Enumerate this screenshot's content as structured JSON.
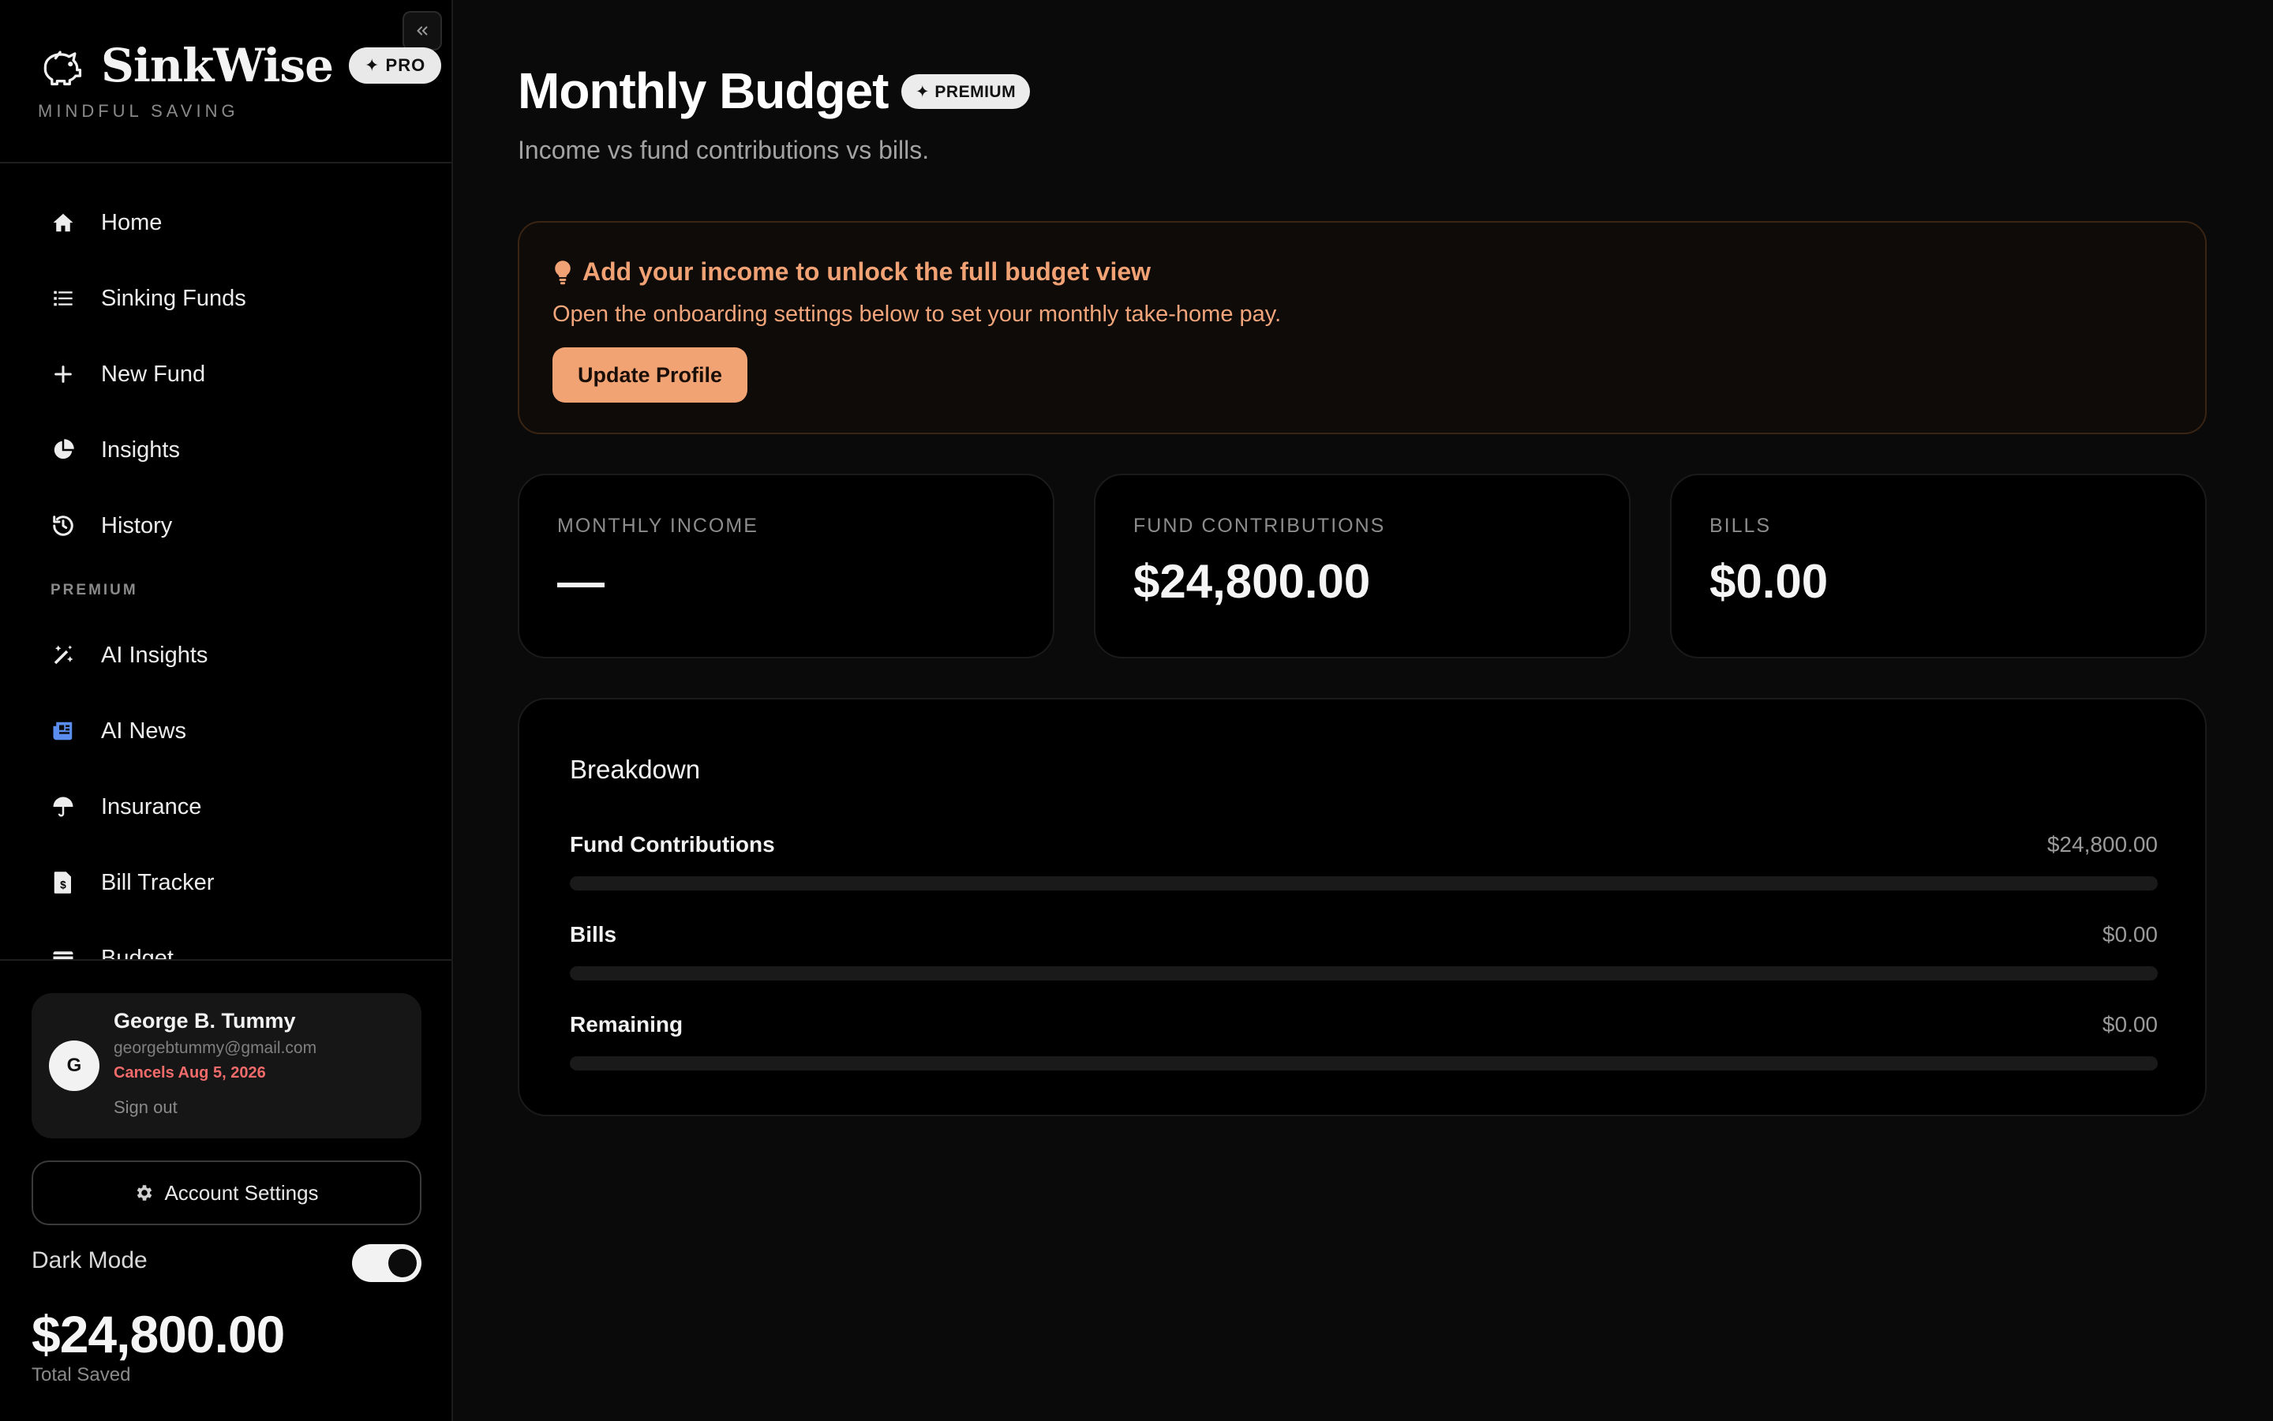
{
  "app": {
    "name": "SinkWise",
    "badge": "✦ PRO",
    "tagline": "MINDFUL SAVING"
  },
  "sidebar": {
    "items": [
      {
        "label": "Home",
        "icon": "home-icon"
      },
      {
        "label": "Sinking Funds",
        "icon": "list-icon"
      },
      {
        "label": "New Fund",
        "icon": "plus-icon"
      },
      {
        "label": "Insights",
        "icon": "pie-chart-icon"
      },
      {
        "label": "History",
        "icon": "history-icon"
      }
    ],
    "premium_label": "PREMIUM",
    "premium_items": [
      {
        "label": "AI Insights",
        "icon": "magic-wand-icon"
      },
      {
        "label": "AI News",
        "icon": "newspaper-icon"
      },
      {
        "label": "Insurance",
        "icon": "umbrella-icon"
      },
      {
        "label": "Bill Tracker",
        "icon": "invoice-icon"
      },
      {
        "label": "Budget",
        "icon": "wallet-icon"
      }
    ]
  },
  "user": {
    "initial": "G",
    "name": "George B. Tummy",
    "email": "georgebtummy@gmail.com",
    "status": "Cancels Aug 5, 2026",
    "sign_out": "Sign out"
  },
  "account_settings": "Account Settings",
  "dark_mode": {
    "label": "Dark Mode",
    "enabled": true
  },
  "total": {
    "amount": "$24,800.00",
    "label": "Total Saved"
  },
  "page": {
    "title": "Monthly Budget",
    "badge": "✦ PREMIUM",
    "subtitle": "Income vs fund contributions vs bills."
  },
  "alert": {
    "title": "Add your income to unlock the full budget view",
    "text": "Open the onboarding settings below to set your monthly take-home pay.",
    "button": "Update Profile"
  },
  "stats": [
    {
      "label": "MONTHLY INCOME",
      "value": "—"
    },
    {
      "label": "FUND CONTRIBUTIONS",
      "value": "$24,800.00"
    },
    {
      "label": "BILLS",
      "value": "$0.00"
    }
  ],
  "breakdown": {
    "title": "Breakdown",
    "rows": [
      {
        "label": "Fund Contributions",
        "value": "$24,800.00",
        "fill": 0
      },
      {
        "label": "Bills",
        "value": "$0.00",
        "fill": 0
      },
      {
        "label": "Remaining",
        "value": "$0.00",
        "fill": 0
      }
    ]
  },
  "colors": {
    "accent": "#f2a373",
    "alert_text": "#f0a274",
    "danger": "#f26b6b",
    "news_icon": "#5b8def"
  }
}
